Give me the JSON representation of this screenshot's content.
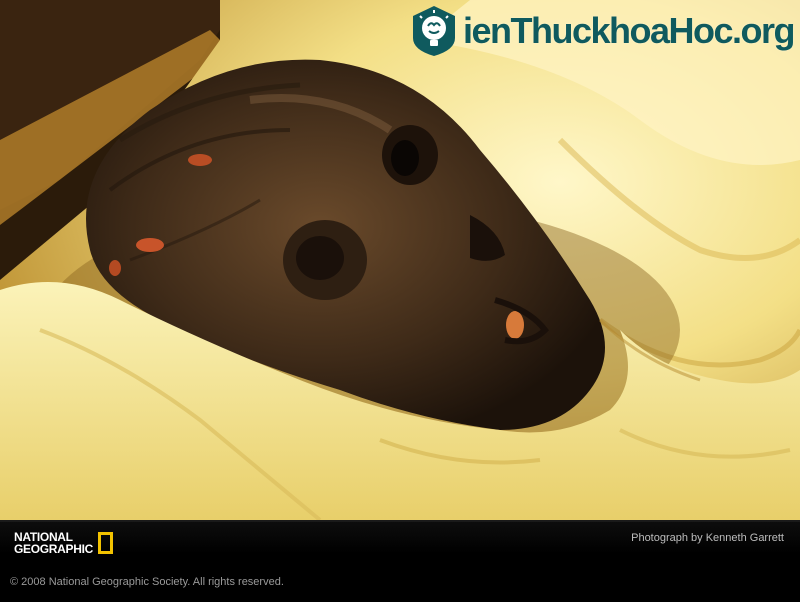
{
  "watermark": {
    "text": "ienThuckhoaHoc.org",
    "icon": "lightbulb-brain-icon",
    "color": "#0f5a5e"
  },
  "footer": {
    "logo_line1": "NATIONAL",
    "logo_line2": "GEOGRAPHIC",
    "logo_accent": "#f2c200",
    "credit": "Photograph by Kenneth Garrett",
    "copyright": "© 2008 National Geographic Society. All rights reserved."
  }
}
